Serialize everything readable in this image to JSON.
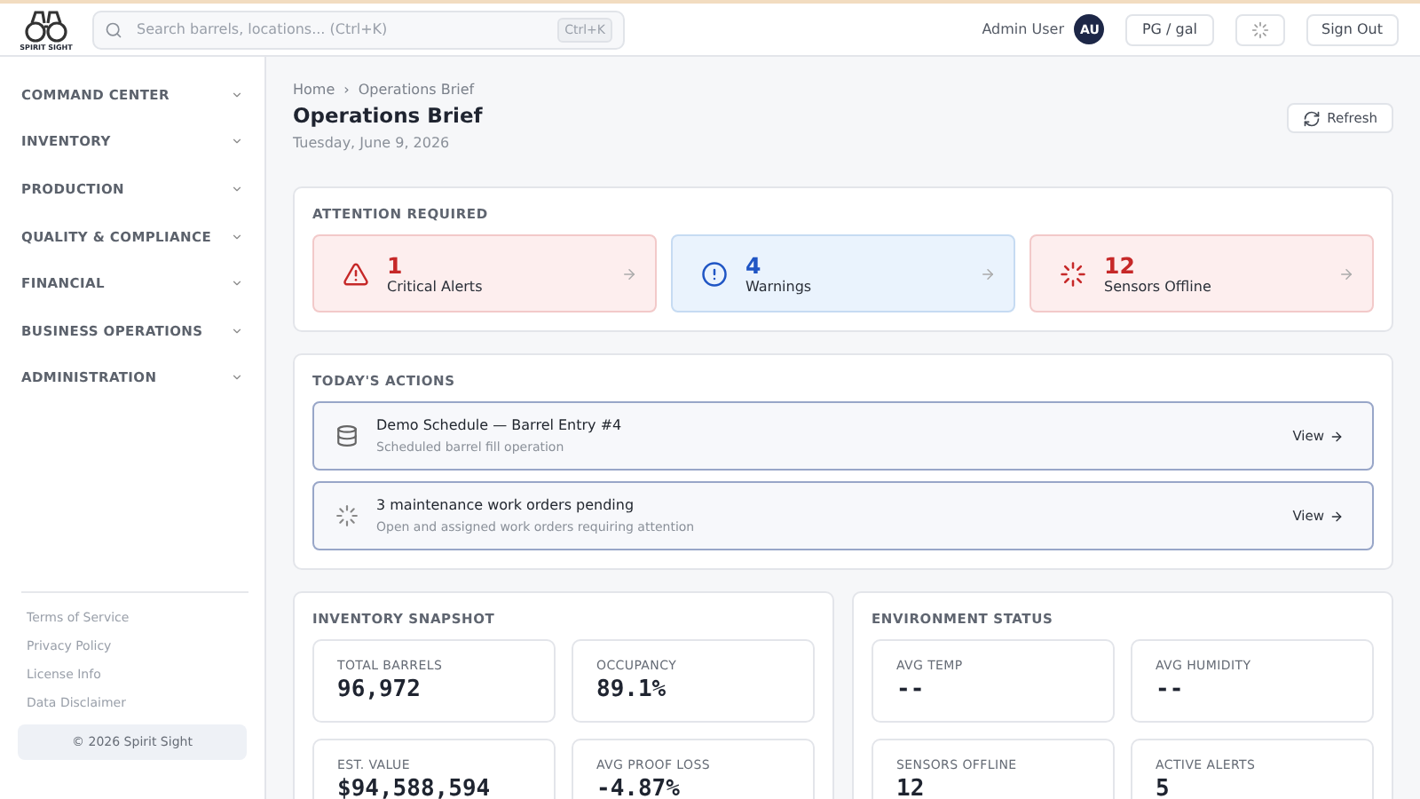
{
  "header": {
    "logo_text": "SPIRIT SIGHT",
    "search": {
      "placeholder": "Search barrels, locations... (Ctrl+K)",
      "shortcut": "Ctrl+K"
    },
    "user_name": "Admin User",
    "avatar_initials": "AU",
    "unit_button": "PG / gal",
    "sign_out": "Sign Out"
  },
  "sidebar": {
    "items": [
      {
        "label": "COMMAND CENTER",
        "expanded": false
      },
      {
        "label": "INVENTORY",
        "expanded": false
      },
      {
        "label": "PRODUCTION",
        "expanded": false
      },
      {
        "label": "QUALITY & COMPLIANCE",
        "expanded": false
      },
      {
        "label": "FINANCIAL",
        "expanded": false
      },
      {
        "label": "BUSINESS OPERATIONS",
        "expanded": false
      },
      {
        "label": "ADMINISTRATION",
        "expanded": false
      }
    ],
    "footer_links": [
      "Terms of Service",
      "Privacy Policy",
      "License Info",
      "Data Disclaimer"
    ],
    "copyright": "© 2026 Spirit Sight"
  },
  "page": {
    "breadcrumb": [
      "Home",
      "Operations Brief"
    ],
    "breadcrumb_separator": "›",
    "title": "Operations Brief",
    "date": "Tuesday, June 9, 2026",
    "refresh_button": "Refresh"
  },
  "attention": {
    "title": "ATTENTION REQUIRED",
    "cards": [
      {
        "kind": "critical",
        "count": "1",
        "label": "Critical Alerts"
      },
      {
        "kind": "warning",
        "count": "4",
        "label": "Warnings"
      },
      {
        "kind": "offline",
        "count": "12",
        "label": "Sensors Offline"
      }
    ]
  },
  "actions": {
    "title": "TODAY'S ACTIONS",
    "items": [
      {
        "kind": "schedule",
        "title": "Demo Schedule — Barrel Entry #4",
        "subtitle": "Scheduled barrel fill operation",
        "link": "View"
      },
      {
        "kind": "maintenance",
        "title": "3 maintenance work orders pending",
        "subtitle": "Open and assigned work orders requiring attention",
        "link": "View"
      }
    ]
  },
  "inventory_snapshot": {
    "title": "INVENTORY SNAPSHOT",
    "stats": [
      {
        "label": "TOTAL BARRELS",
        "value": "96,972"
      },
      {
        "label": "OCCUPANCY",
        "value": "89.1%"
      },
      {
        "label": "EST. VALUE",
        "value": "$94,588,594"
      },
      {
        "label": "AVG PROOF LOSS",
        "value": "-4.87%"
      }
    ]
  },
  "environment_status": {
    "title": "ENVIRONMENT STATUS",
    "stats": [
      {
        "label": "AVG TEMP",
        "value": "--"
      },
      {
        "label": "AVG HUMIDITY",
        "value": "--"
      },
      {
        "label": "SENSORS OFFLINE",
        "value": "12"
      },
      {
        "label": "ACTIVE ALERTS",
        "value": "5"
      }
    ]
  }
}
